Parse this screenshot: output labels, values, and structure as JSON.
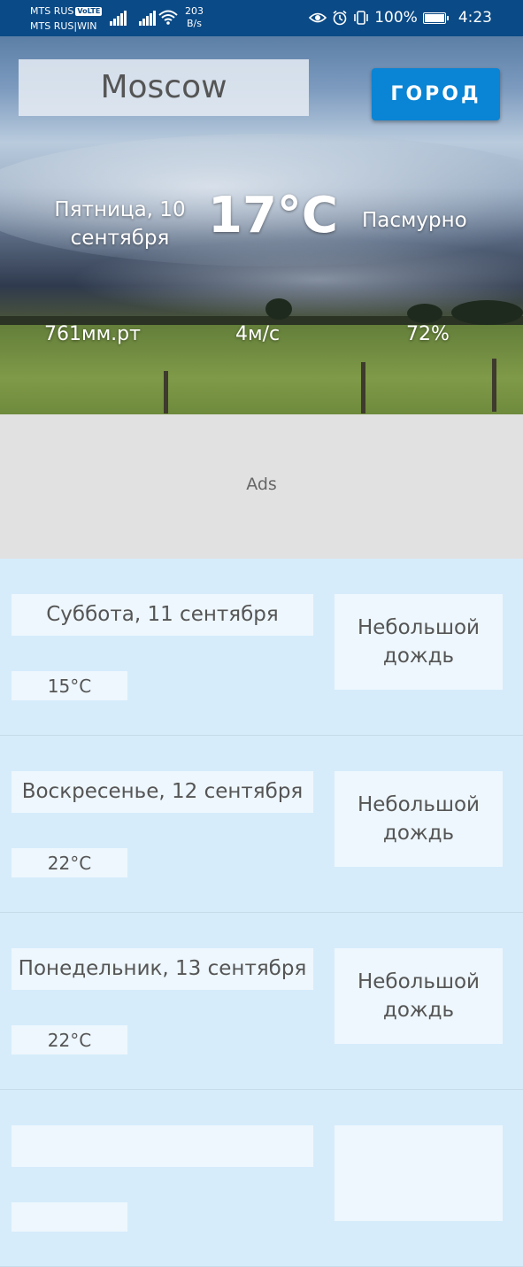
{
  "status_bar": {
    "carrier1": "MTS RUS",
    "carrier1_badge": "VoLTE",
    "carrier2": "MTS RUS|WIN",
    "net_speed_value": "203",
    "net_speed_unit": "B/s",
    "battery": "100%",
    "time": "4:23",
    "icons": [
      "signal-icon",
      "signal-icon",
      "wifi-icon",
      "eye-icon",
      "alarm-icon",
      "vibrate-icon",
      "battery-icon"
    ]
  },
  "header": {
    "city": "Moscow",
    "city_button": "ГОРОД"
  },
  "current": {
    "date": "Пятница, 10 сентября",
    "temperature": "17°C",
    "condition": "Пасмурно",
    "pressure": "761мм.рт",
    "wind": "4м/с",
    "humidity": "72%"
  },
  "ads": {
    "label": "Ads"
  },
  "forecast": [
    {
      "date": "Суббота, 11 сентября",
      "temperature": "15°C",
      "condition": "Небольшой дождь"
    },
    {
      "date": "Воскресенье, 12 сентября",
      "temperature": "22°C",
      "condition": "Небольшой дождь"
    },
    {
      "date": "Понедельник, 13 сентября",
      "temperature": "22°C",
      "condition": "Небольшой дождь"
    },
    {
      "date": "",
      "temperature": "",
      "condition": ""
    }
  ],
  "colors": {
    "status_bar": "#0a4a86",
    "accent_button": "#0a84d4",
    "forecast_background": "#d6ecfb",
    "ads_background": "#e1e1e1"
  }
}
